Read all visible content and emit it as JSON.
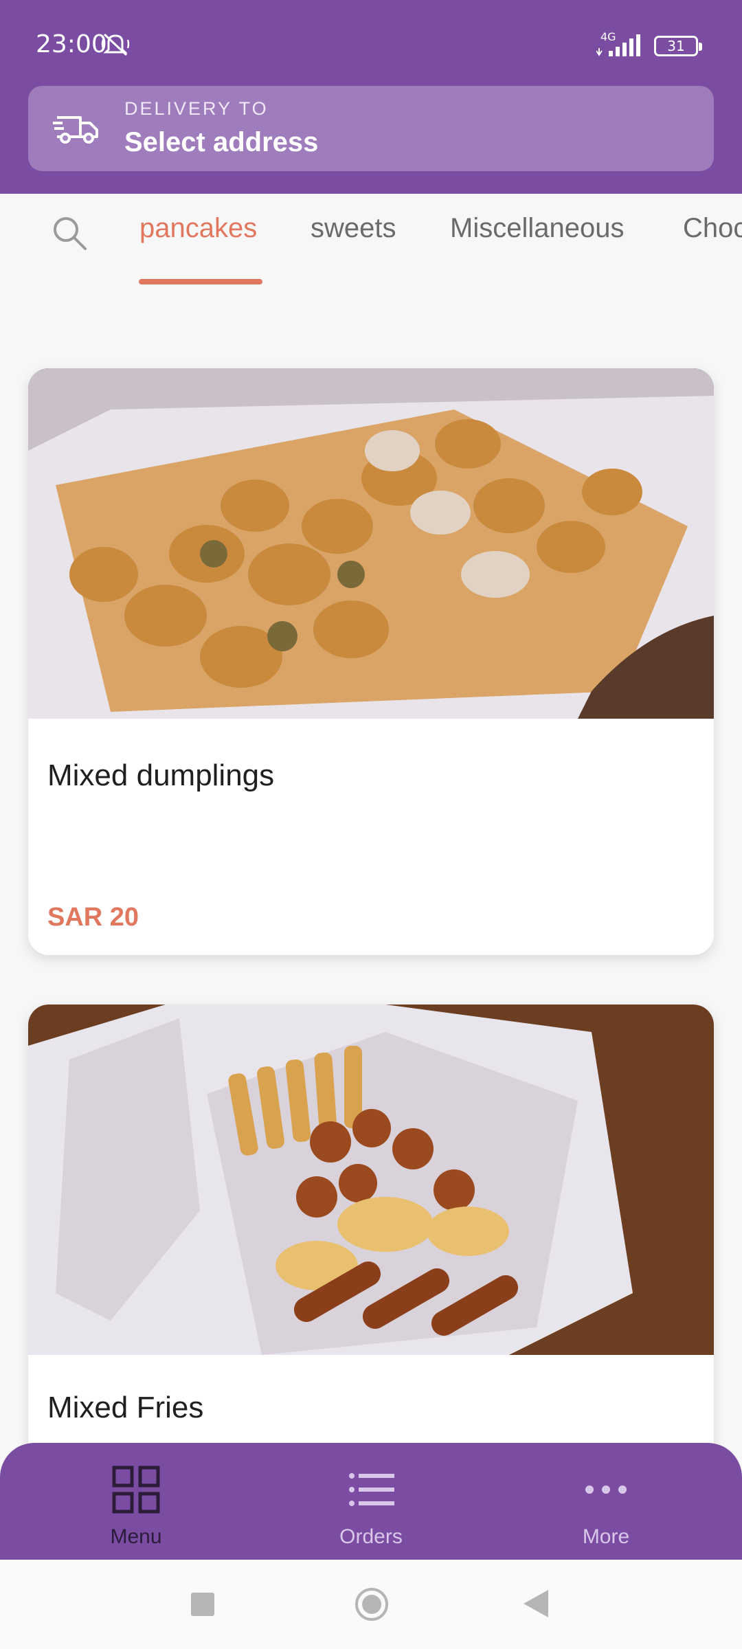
{
  "status_bar": {
    "time": "23:00",
    "network_label": "4G",
    "battery": "31",
    "icons": [
      "mute-bell-icon",
      "signal-icon",
      "battery-icon"
    ]
  },
  "delivery": {
    "label": "DELIVERY TO",
    "address": "Select address",
    "icon": "truck-icon"
  },
  "tabs": [
    {
      "label": "pancakes",
      "active": true
    },
    {
      "label": "sweets",
      "active": false
    },
    {
      "label": "Miscellaneous",
      "active": false
    },
    {
      "label": "Choc",
      "active": false
    }
  ],
  "products": [
    {
      "name": "Mixed dumplings",
      "price": "SAR 20"
    },
    {
      "name": "Mixed Fries",
      "price": ""
    }
  ],
  "bottom_nav": [
    {
      "label": "Menu",
      "icon": "grid-icon",
      "active": true
    },
    {
      "label": "Orders",
      "icon": "list-icon",
      "active": false
    },
    {
      "label": "More",
      "icon": "more-dots-icon",
      "active": false
    }
  ],
  "colors": {
    "brand": "#7a4ca2",
    "accent": "#e0775e",
    "background": "#f7f7f7"
  }
}
